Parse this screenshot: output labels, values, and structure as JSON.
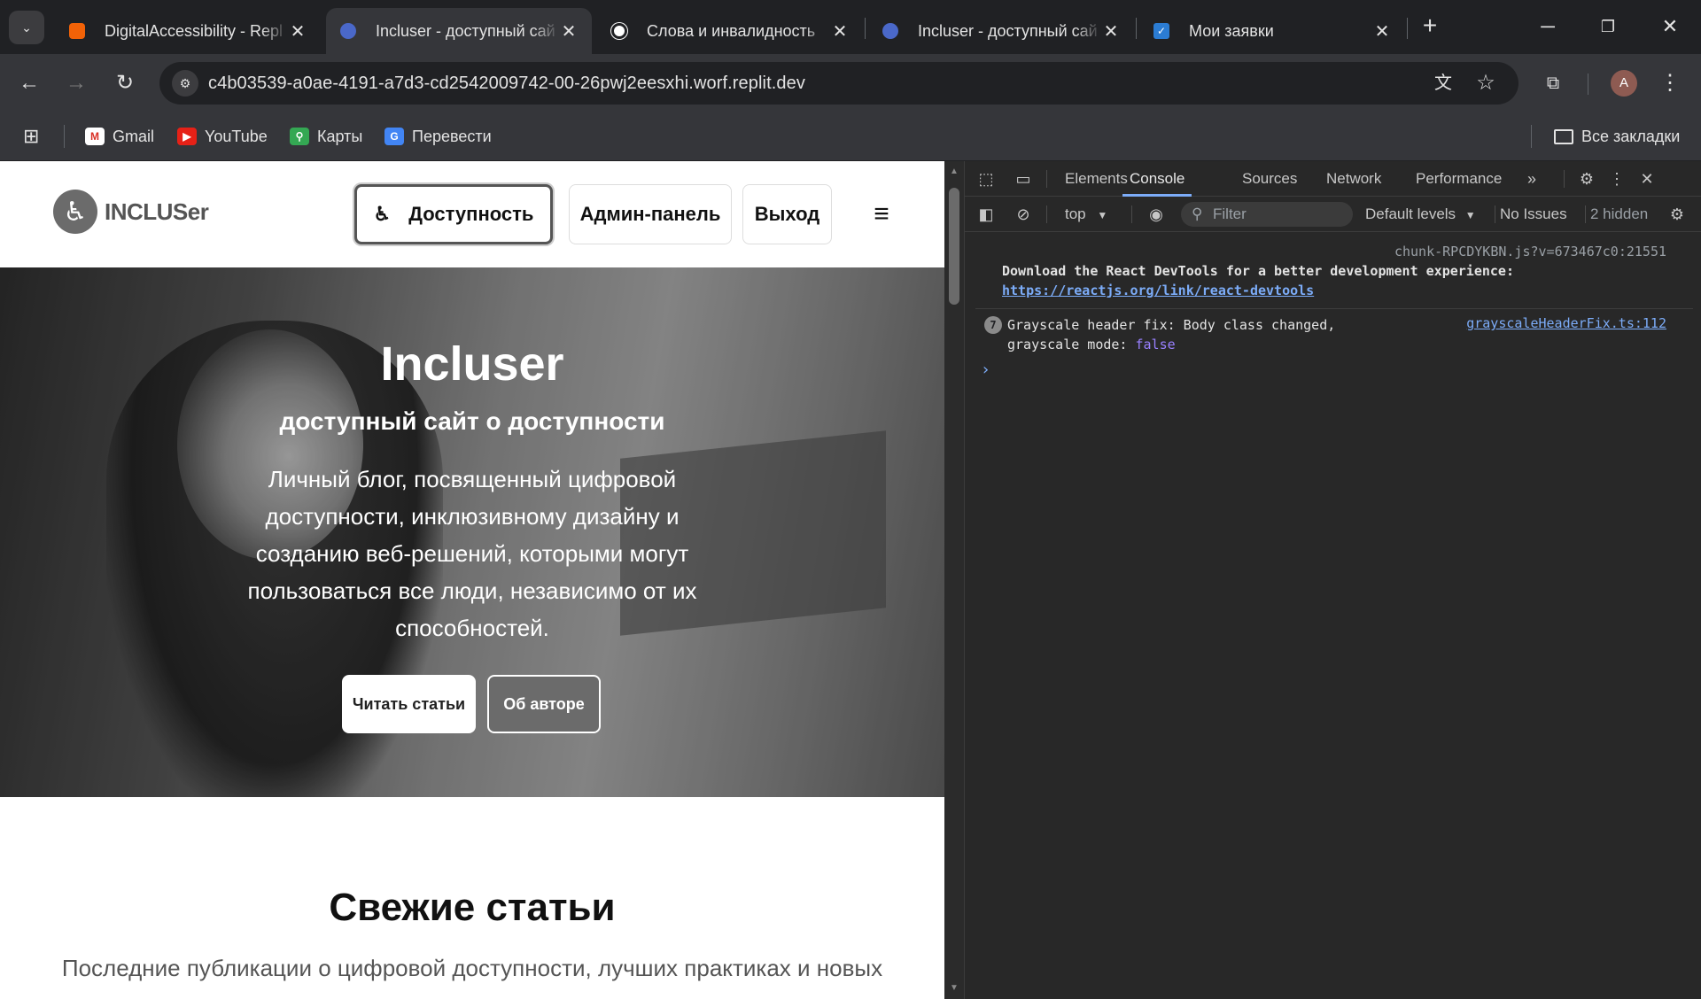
{
  "browser": {
    "tabs": [
      {
        "title": "DigitalAccessibility - Repl",
        "active": false
      },
      {
        "title": "Incluser - доступный сай",
        "active": true
      },
      {
        "title": "Слова и инвалидность",
        "active": false
      },
      {
        "title": "Incluser - доступный сай",
        "active": false
      },
      {
        "title": "Мои заявки",
        "active": false
      }
    ],
    "url": "c4b03539-a0ae-4191-a7d3-cd2542009742-00-26pwj2eesxhi.worf.replit.dev",
    "profile_initial": "A",
    "bookmarks": [
      "Gmail",
      "YouTube",
      "Карты",
      "Перевести"
    ],
    "all_bookmarks_label": "Все закладки"
  },
  "site": {
    "logo_text": "INCLUSer",
    "nav": {
      "accessibility": "Доступность",
      "admin": "Админ-панель",
      "logout": "Выход"
    },
    "hero": {
      "title": "Incluser",
      "subtitle": "доступный сайт о доступности",
      "description": "Личный блог, посвященный цифровой доступности, инклюзивному дизайну и созданию веб-решений, которыми могут пользоваться все люди, независимо от их способностей.",
      "read_button": "Читать статьи",
      "about_button": "Об авторе"
    },
    "section": {
      "title": "Свежие статьи",
      "subtitle": "Последние публикации о цифровой доступности, лучших практиках и новых"
    }
  },
  "devtools": {
    "tabs": [
      "Elements",
      "Console",
      "Sources",
      "Network",
      "Performance"
    ],
    "active_tab": "Console",
    "context": "top",
    "filter_placeholder": "Filter",
    "levels": "Default levels",
    "issues": "No Issues",
    "hidden": "2 hidden",
    "messages": [
      {
        "source": "chunk-RPCDYKBN.js?v=673467c0:21551",
        "text": "Download the React DevTools for a better development experience:",
        "link": "https://reactjs.org/link/react-devtools"
      },
      {
        "count": "7",
        "source": "grayscaleHeaderFix.ts:112",
        "line1": "Grayscale header fix: Body class changed,",
        "line2_prefix": "grayscale mode:",
        "value": "false"
      }
    ]
  },
  "colors": {
    "chrome_dark": "#202124",
    "toolbar": "#35363a",
    "devtools_bg": "#282828",
    "accent_blue": "#7cacf8"
  }
}
